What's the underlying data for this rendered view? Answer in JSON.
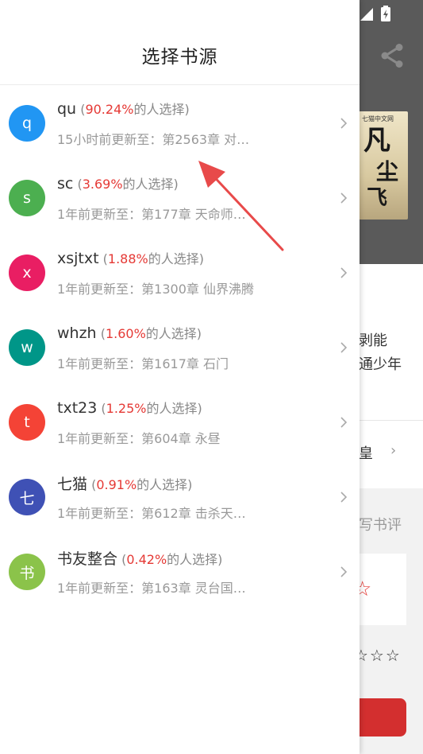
{
  "drawer": {
    "title": "选择书源"
  },
  "sources": [
    {
      "letter": "q",
      "color": "#2196f3",
      "name": "qu",
      "percent": "90.24%",
      "suffix": "的人选择)",
      "open": " (",
      "update": "15小时前更新至：第2563章 对…"
    },
    {
      "letter": "s",
      "color": "#4caf50",
      "name": "sc",
      "percent": "3.69%",
      "suffix": "的人选择)",
      "open": " (",
      "update": "1年前更新至：第177章 天命师…"
    },
    {
      "letter": "x",
      "color": "#e91e63",
      "name": "xsjtxt",
      "percent": "1.88%",
      "suffix": "的人选择)",
      "open": " (",
      "update": "1年前更新至：第1300章 仙界沸腾"
    },
    {
      "letter": "w",
      "color": "#009688",
      "name": "whzh",
      "percent": "1.60%",
      "suffix": "的人选择)",
      "open": " (",
      "update": "1年前更新至：第1617章 石门"
    },
    {
      "letter": "t",
      "color": "#f44336",
      "name": "txt23",
      "percent": "1.25%",
      "suffix": "的人选择)",
      "open": " (",
      "update": "1年前更新至：第604章 永昼"
    },
    {
      "letter": "七",
      "color": "#3f51b5",
      "name": "七猫",
      "percent": "0.91%",
      "suffix": "的人选择)",
      "open": " (",
      "update": "1年前更新至：第612章  击杀天…"
    },
    {
      "letter": "书",
      "color": "#8bc34a",
      "name": "书友整合",
      "percent": "0.42%",
      "suffix": "的人选择)",
      "open": " (",
      "update": "1年前更新至：第163章 灵台国…"
    }
  ],
  "background": {
    "cover_tag": "七猫中文网",
    "cover_glyphs": [
      "凡",
      "尘",
      "飞"
    ],
    "text1": "剥能",
    "text2": "通少年",
    "text3": "皇",
    "review_label": "写书评",
    "stars": "☆☆☆"
  }
}
